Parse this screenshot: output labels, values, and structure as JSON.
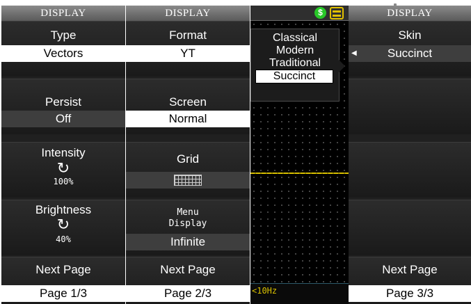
{
  "columns": [
    {
      "header": "DISPLAY",
      "slots": [
        {
          "label": "Type",
          "value": "Vectors"
        },
        {
          "label": "Persist",
          "value": "Off"
        },
        {
          "label": "Intensity",
          "knob": "↻",
          "value": "100%"
        },
        {
          "label": "Brightness",
          "knob": "↻",
          "value": "40%"
        },
        {
          "label": "Next Page",
          "value": "Page 1/3"
        }
      ]
    },
    {
      "header": "DISPLAY",
      "slots": [
        {
          "label": "Format",
          "value": "YT"
        },
        {
          "label": "Screen",
          "value": "Normal"
        },
        {
          "label": "Grid",
          "icon": "grid-icon"
        },
        {
          "label_line1": "Menu",
          "label_line2": "Display",
          "value": "Infinite"
        },
        {
          "label": "Next Page",
          "value": "Page 2/3"
        }
      ]
    },
    {
      "header": "DISPLAY",
      "slots": [
        {
          "label": "Skin",
          "value": "Succinct"
        },
        {
          "label": "Next Page",
          "value": "Page 3/3"
        }
      ]
    }
  ],
  "scope": {
    "freq": "<10Hz",
    "icons": [
      "dollar-icon",
      "printer-icon"
    ],
    "accent": "#d8c000"
  },
  "skin_popup": {
    "options": [
      "Classical",
      "Modern",
      "Traditional",
      "Succinct"
    ],
    "selected": "Succinct"
  },
  "colors": {
    "panel": "#202020",
    "header": "#6a6a6a",
    "trace": "#d8c000",
    "selection": "#ffffff"
  }
}
